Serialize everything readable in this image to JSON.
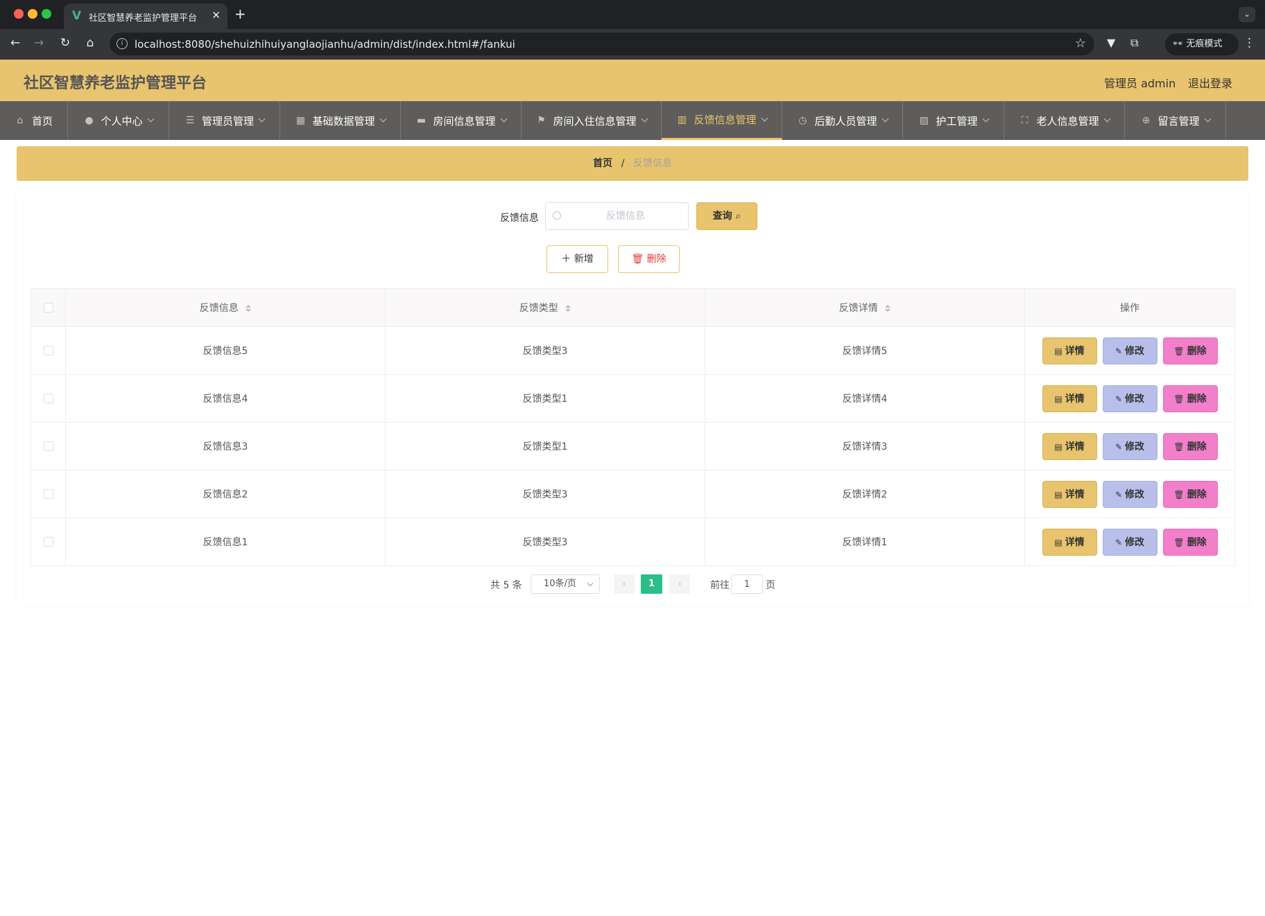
{
  "browser": {
    "tab_title": "社区智慧养老监护管理平台",
    "url": "localhost:8080/shehuizhihuiyanglaojianhu/admin/dist/index.html#/fankui",
    "incognito_label": "无痕模式"
  },
  "header": {
    "title": "社区智慧养老监护管理平台",
    "admin_label": "管理员 admin",
    "logout_label": "退出登录"
  },
  "nav": {
    "items": [
      {
        "label": "首页",
        "icon": "home-icon"
      },
      {
        "label": "个人中心",
        "icon": "user-icon"
      },
      {
        "label": "管理员管理",
        "icon": "list-icon"
      },
      {
        "label": "基础数据管理",
        "icon": "grid-icon"
      },
      {
        "label": "房间信息管理",
        "icon": "briefcase-icon"
      },
      {
        "label": "房间入住信息管理",
        "icon": "flag-icon"
      },
      {
        "label": "反馈信息管理",
        "icon": "chart-icon",
        "active": true
      },
      {
        "label": "后勤人员管理",
        "icon": "clock-icon"
      },
      {
        "label": "护工管理",
        "icon": "chart-line-icon"
      },
      {
        "label": "老人信息管理",
        "icon": "fullscreen-icon"
      },
      {
        "label": "留言管理",
        "icon": "target-icon"
      }
    ]
  },
  "breadcrumb": {
    "home": "首页",
    "separator": "/",
    "current": "反馈信息"
  },
  "search": {
    "label": "反馈信息",
    "placeholder": "反馈信息",
    "query_label": "查询"
  },
  "actions": {
    "add_label": "新增",
    "delete_label": "删除"
  },
  "table": {
    "columns": [
      "反馈信息",
      "反馈类型",
      "反馈详情",
      "操作"
    ],
    "row_actions": {
      "detail": "详情",
      "edit": "修改",
      "delete": "删除"
    },
    "rows": [
      {
        "info": "反馈信息5",
        "type": "反馈类型3",
        "detail": "反馈详情5"
      },
      {
        "info": "反馈信息4",
        "type": "反馈类型1",
        "detail": "反馈详情4"
      },
      {
        "info": "反馈信息3",
        "type": "反馈类型1",
        "detail": "反馈详情3"
      },
      {
        "info": "反馈信息2",
        "type": "反馈类型3",
        "detail": "反馈详情2"
      },
      {
        "info": "反馈信息1",
        "type": "反馈类型3",
        "detail": "反馈详情1"
      }
    ]
  },
  "pagination": {
    "total_text": "共 5 条",
    "page_size": "10条/页",
    "current_page": "1",
    "goto_label": "前往",
    "goto_value": "1",
    "page_suffix": "页"
  },
  "colors": {
    "accent": "#e8c46e",
    "nav_bg": "#5f5d5b",
    "page_active": "#2bbd8a",
    "edit_btn": "#b8bfea",
    "delete_btn": "#f27fca"
  }
}
